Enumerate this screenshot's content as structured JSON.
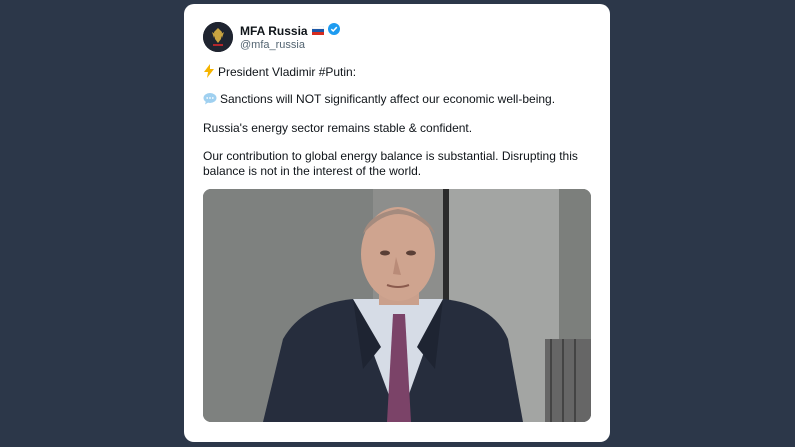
{
  "account": {
    "name": "MFA Russia",
    "handle": "@mfa_russia",
    "flag_icon": "russian-flag-icon",
    "verified_icon": "verified-badge-icon",
    "verified_color": "#1d9bf0"
  },
  "tweet": {
    "line1": "President Vladimir #Putin:",
    "line2": "Sanctions will NOT significantly affect our economic well-being.",
    "line3": "Russia's energy sector remains stable & confident.",
    "line4": "Our contribution to global energy balance is substantial. Disrupting this balance is not in the interest of the world.",
    "line1_icon": "lightning-icon",
    "line2_icon": "speech-bubble-icon"
  },
  "colors": {
    "background": "#2c3749",
    "card": "#ffffff",
    "text": "#0f1419",
    "secondary_text": "#536471"
  }
}
